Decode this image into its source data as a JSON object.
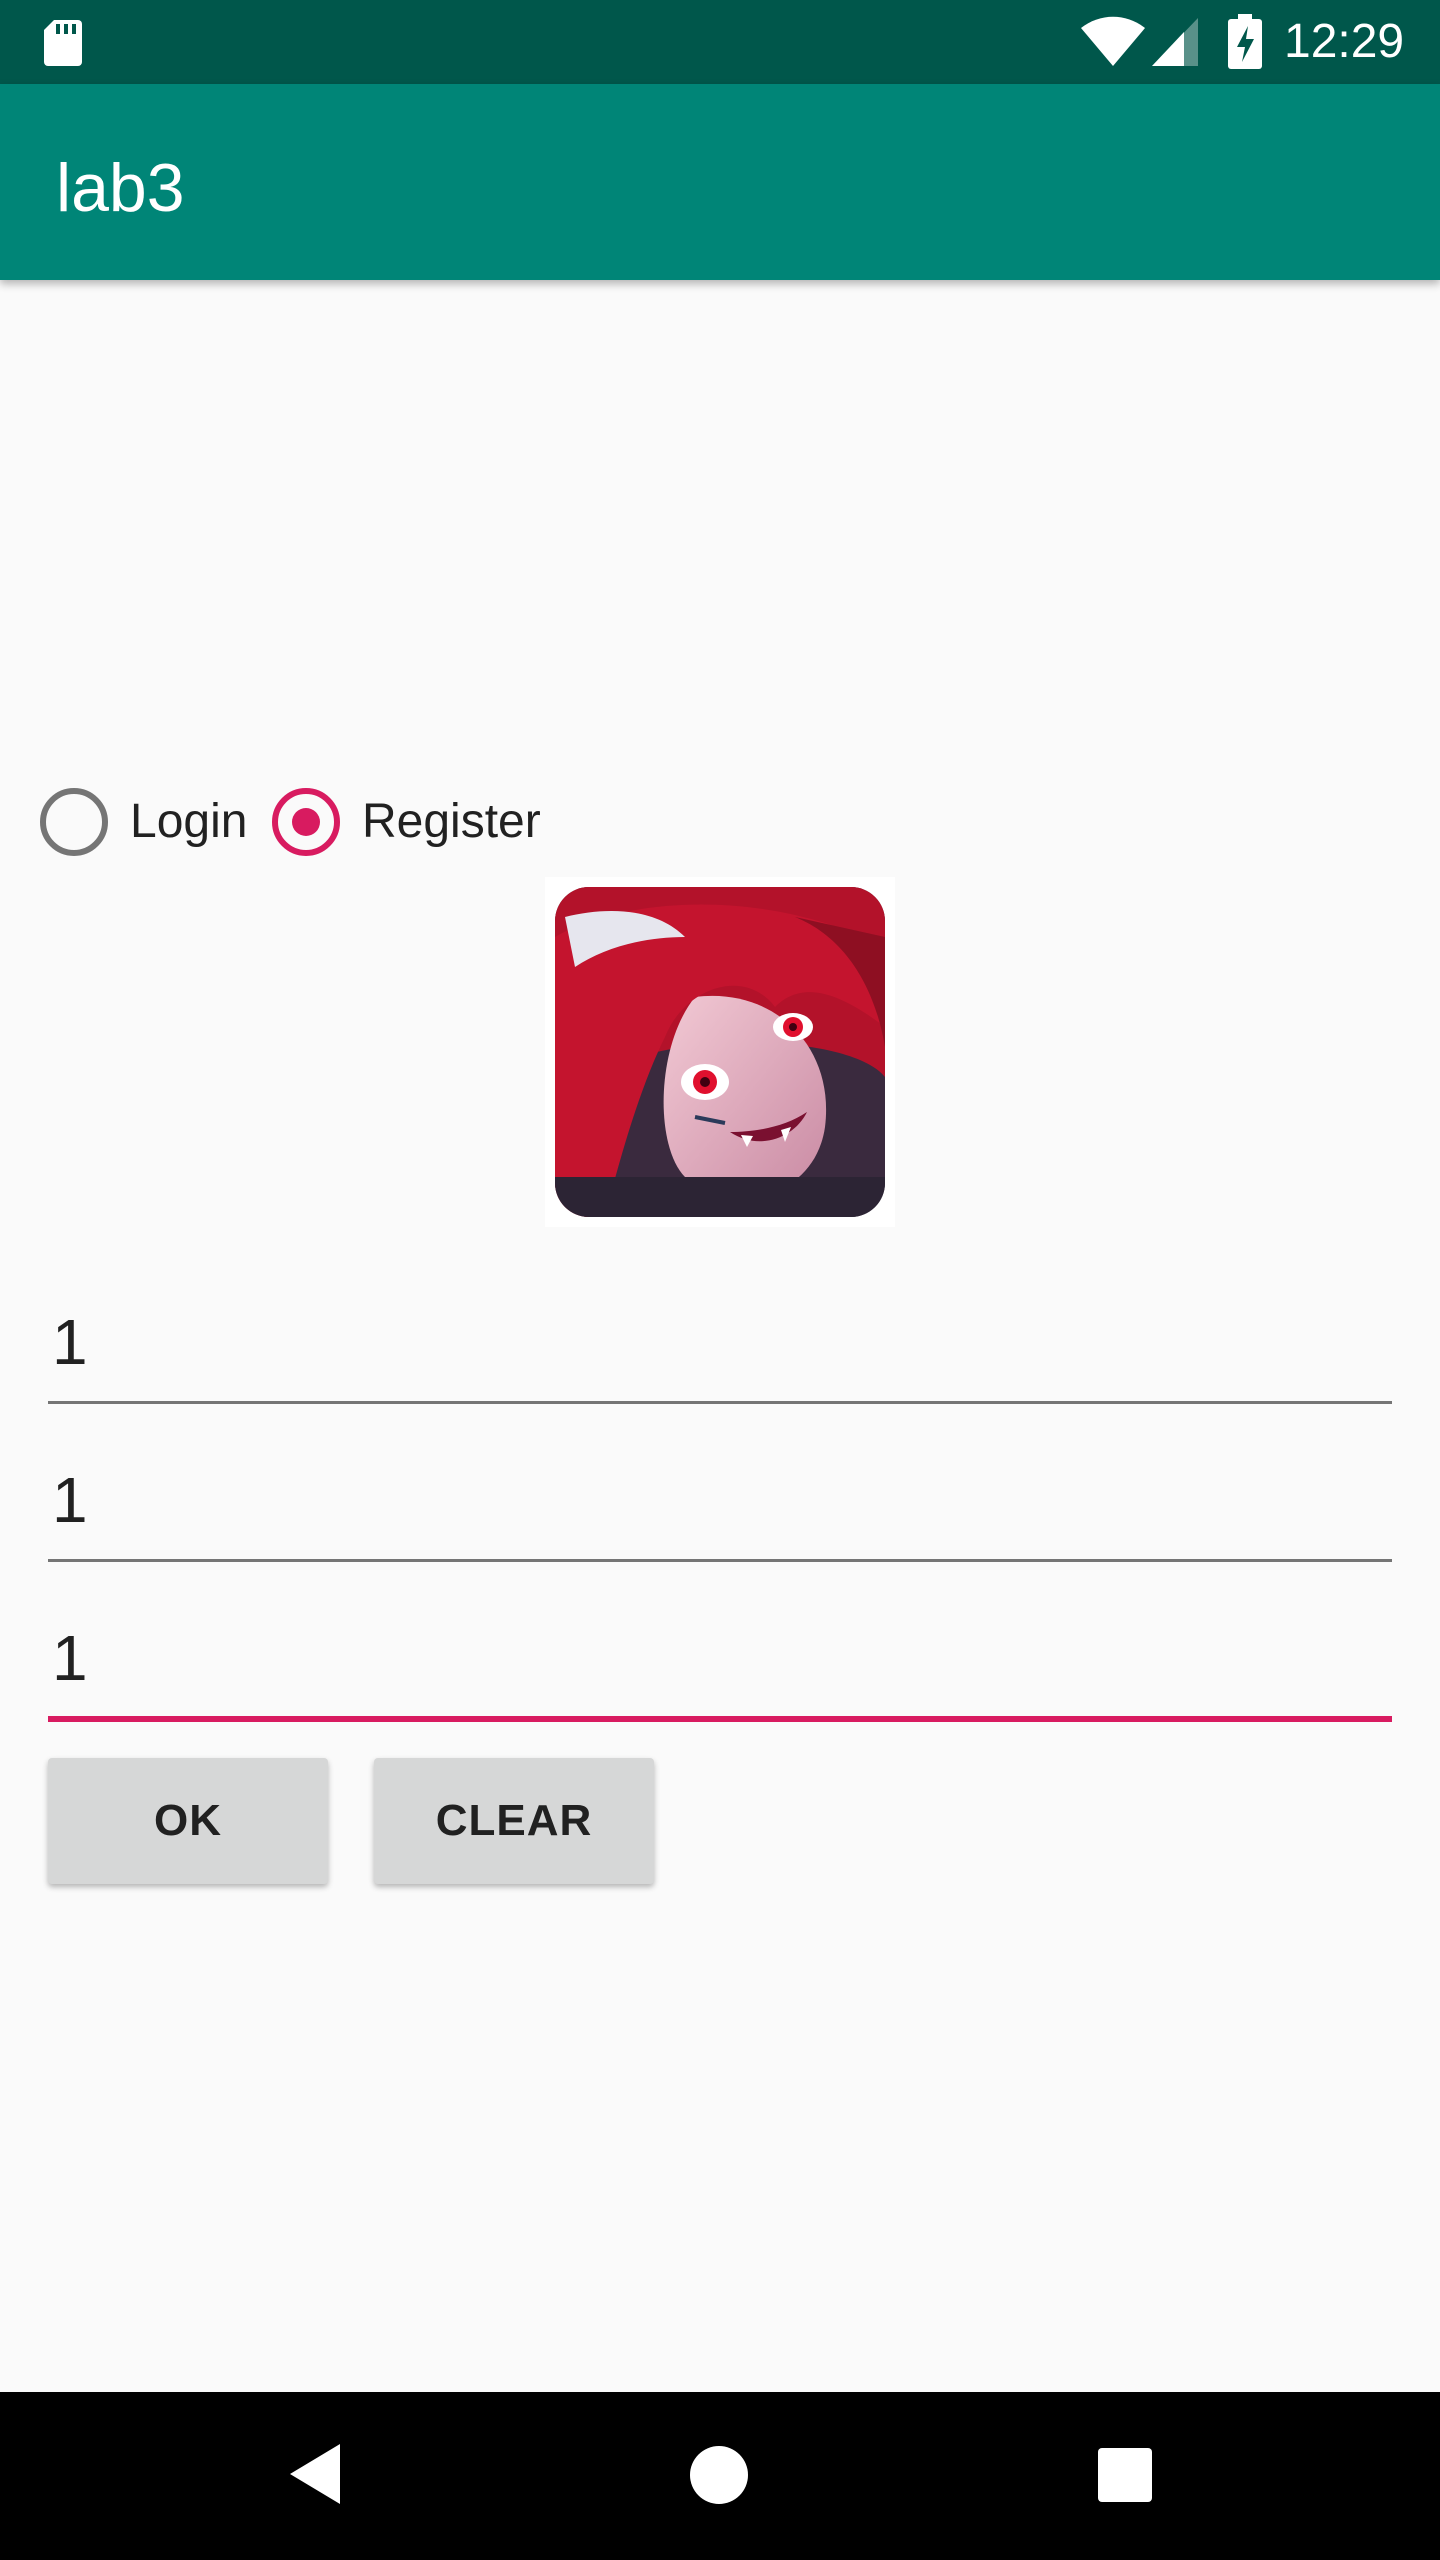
{
  "status_bar": {
    "time": "12:29",
    "icons": [
      "sd-card-icon",
      "wifi-icon",
      "cell-signal-icon",
      "battery-charging-icon"
    ]
  },
  "app_bar": {
    "title": "lab3"
  },
  "mode_selector": {
    "options": [
      {
        "label": "Login",
        "checked": false
      },
      {
        "label": "Register",
        "checked": true
      }
    ]
  },
  "avatar": {
    "description": "avatar-image"
  },
  "form": {
    "fields": [
      {
        "value": "1",
        "focused": false
      },
      {
        "value": "1",
        "focused": false
      },
      {
        "value": "1",
        "focused": true
      }
    ]
  },
  "buttons": {
    "ok_label": "OK",
    "clear_label": "CLEAR"
  },
  "nav_bar": {
    "icons": [
      "back-icon",
      "home-icon",
      "recents-icon"
    ]
  },
  "colors": {
    "status_bar": "#00574b",
    "primary": "#008577",
    "accent": "#d81b60",
    "background": "#fafafa",
    "button": "#d6d7d7"
  }
}
